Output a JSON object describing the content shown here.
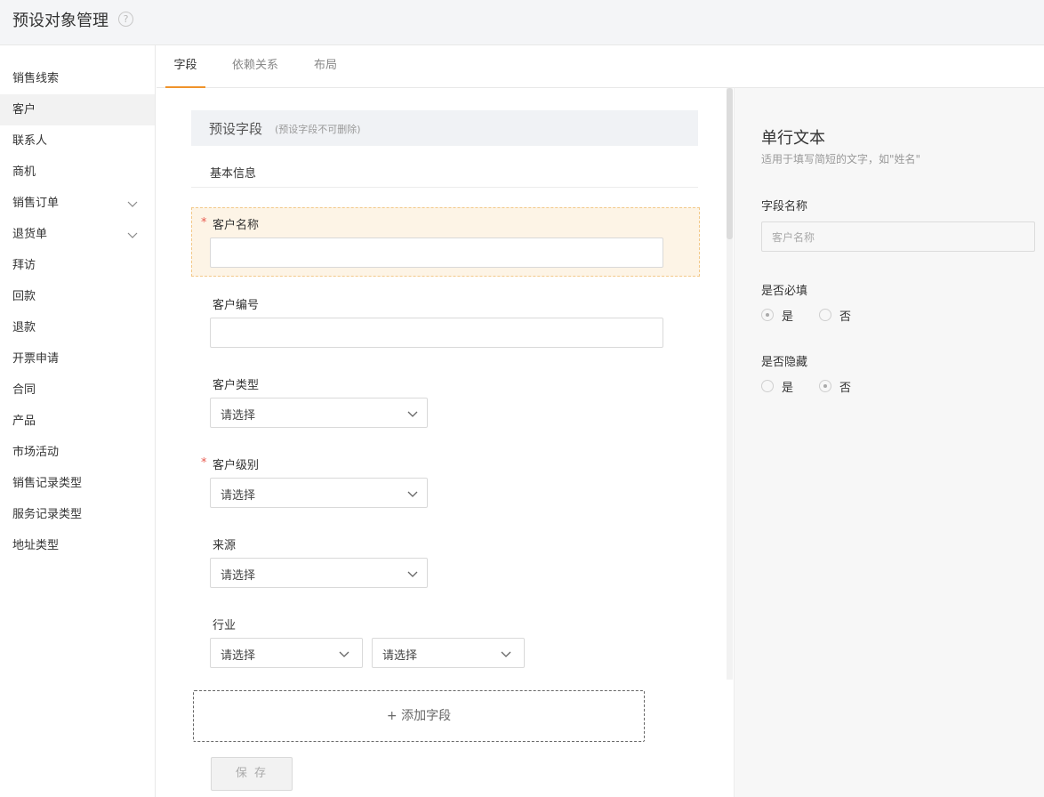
{
  "header": {
    "title": "预设对象管理",
    "help": "?"
  },
  "sidebar": {
    "items": [
      {
        "label": "销售线索"
      },
      {
        "label": "客户"
      },
      {
        "label": "联系人"
      },
      {
        "label": "商机"
      },
      {
        "label": "销售订单"
      },
      {
        "label": "退货单"
      },
      {
        "label": "拜访"
      },
      {
        "label": "回款"
      },
      {
        "label": "退款"
      },
      {
        "label": "开票申请"
      },
      {
        "label": "合同"
      },
      {
        "label": "产品"
      },
      {
        "label": "市场活动"
      },
      {
        "label": "销售记录类型"
      },
      {
        "label": "服务记录类型"
      },
      {
        "label": "地址类型"
      }
    ],
    "active_index": 1
  },
  "tabs": [
    {
      "label": "字段"
    },
    {
      "label": "依赖关系"
    },
    {
      "label": "布局"
    }
  ],
  "form": {
    "section_title": "预设字段",
    "section_note": "(预设字段不可删除)",
    "subsection": "基本信息",
    "required_mark": "*",
    "fields": {
      "name": {
        "label": "客户名称"
      },
      "code": {
        "label": "客户编号"
      },
      "type": {
        "label": "客户类型",
        "placeholder": "请选择"
      },
      "level": {
        "label": "客户级别",
        "placeholder": "请选择"
      },
      "source": {
        "label": "来源",
        "placeholder": "请选择"
      },
      "industry": {
        "label": "行业",
        "placeholder1": "请选择",
        "placeholder2": "请选择"
      }
    },
    "add_field": "+ 添加字段",
    "save": "保 存"
  },
  "panel": {
    "title": "单行文本",
    "desc": "适用于填写简短的文字，如\"姓名\"",
    "field_name_label": "字段名称",
    "field_name_value": "客户名称",
    "required_label": "是否必填",
    "hidden_label": "是否隐藏",
    "yes": "是",
    "no": "否",
    "required_value": "是",
    "hidden_value": "否"
  },
  "colors": {
    "accent": "#f0932b",
    "required": "#e85a4f"
  }
}
